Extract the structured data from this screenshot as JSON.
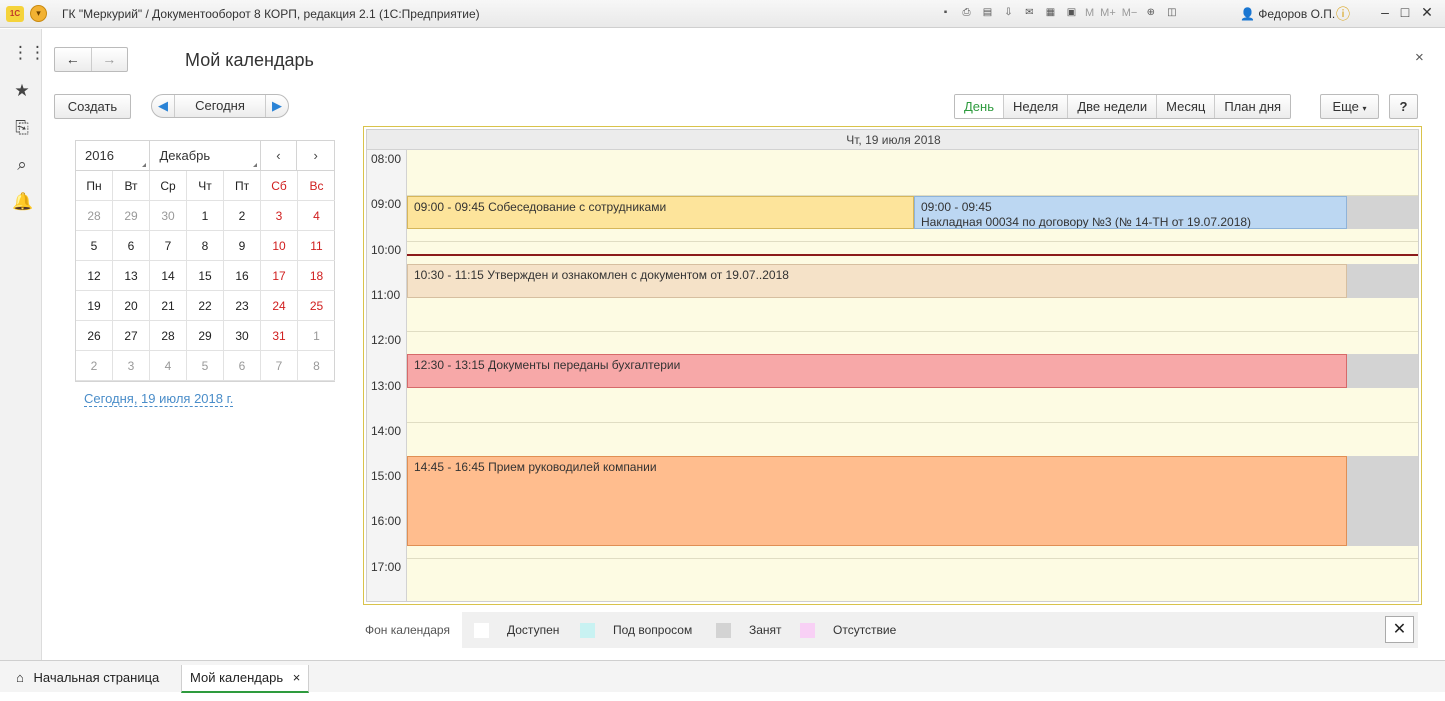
{
  "app": {
    "title": "ГК \"Меркурий\" / Документооборот 8 КОРП, редакция 2.1  (1С:Предприятие)",
    "user": "Федоров О.П.",
    "toolbar_text_icons": [
      "M",
      "M+",
      "M−"
    ]
  },
  "header": {
    "page_title": "Мой календарь",
    "create_label": "Создать",
    "today_label": "Сегодня",
    "more_label": "Еще",
    "help_label": "?"
  },
  "views": [
    "День",
    "Неделя",
    "Две недели",
    "Месяц",
    "План дня"
  ],
  "mini_calendar": {
    "year": "2016",
    "month": "Декабрь",
    "weekdays": [
      "Пн",
      "Вт",
      "Ср",
      "Чт",
      "Пт",
      "Сб",
      "Вс"
    ],
    "weeks": [
      [
        "28",
        "29",
        "30",
        "1",
        "2",
        "3",
        "4"
      ],
      [
        "5",
        "6",
        "7",
        "8",
        "9",
        "10",
        "11"
      ],
      [
        "12",
        "13",
        "14",
        "15",
        "16",
        "17",
        "18"
      ],
      [
        "19",
        "20",
        "21",
        "22",
        "23",
        "24",
        "25"
      ],
      [
        "26",
        "27",
        "28",
        "29",
        "30",
        "31",
        "1"
      ],
      [
        "2",
        "3",
        "4",
        "5",
        "6",
        "7",
        "8"
      ]
    ],
    "today_link": "Сегодня, 19 июля 2018 г."
  },
  "scheduler": {
    "day_title": "Чт, 19 июля 2018",
    "hours": [
      "08:00",
      "09:00",
      "10:00",
      "11:00",
      "12:00",
      "13:00",
      "14:00",
      "15:00",
      "16:00",
      "17:00"
    ],
    "events": [
      {
        "time": "09:00 - 09:45",
        "title": "Собеседование с сотрудниками",
        "color": "#fde49b",
        "border": "#d6b65a"
      },
      {
        "time": "09:00 - 09:45",
        "title": "Накладная 00034 по договору №3 (№ 14-ТН от 19.07.2018)",
        "color": "#bcd7f2",
        "border": "#8fb3d9"
      },
      {
        "time": "10:30 - 11:15",
        "title": "Утвержден и ознакомлен с документом от 19.07..2018",
        "color": "#f5e2c8",
        "border": "#d6bfa0"
      },
      {
        "time": "12:30 - 13:15",
        "title": "Документы переданы бухгалтерии",
        "color": "#f7a8a8",
        "border": "#d66a6a"
      },
      {
        "time": "14:45 - 16:45",
        "title": "Прием руководилей компании",
        "color": "#ffbd8e",
        "border": "#e08f54"
      }
    ]
  },
  "legend": {
    "title": "Фон календаря",
    "items": [
      {
        "label": "Доступен",
        "color": "#ffffff"
      },
      {
        "label": "Под вопросом",
        "color": "#c8f2f2"
      },
      {
        "label": "Занят",
        "color": "#d3d3d3"
      },
      {
        "label": "Отсутствие",
        "color": "#f8d0f5"
      }
    ]
  },
  "tabs": {
    "home": "Начальная страница",
    "active": "Мой календарь"
  }
}
